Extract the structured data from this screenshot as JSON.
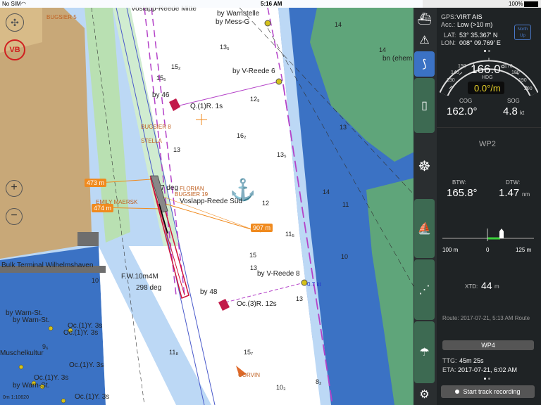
{
  "status": {
    "carrier": "No SIM",
    "time": "5:16 AM",
    "battery": "100%"
  },
  "map": {
    "labels": {
      "voslapp_mitte": "Voslapp-Reede Mitte",
      "warnstelle": "by Warnstelle",
      "mess_g": "by Mess-G",
      "bugsier5": "BUGSIER 5",
      "v_reede6": "by V-Reede 6",
      "by46": "by 46",
      "q1r": "Q.(1)R. 1s",
      "bugsier": "BUGSIER 8",
      "stella": "STELLA",
      "deg_label": "7 deg",
      "florian": "FLORIAN",
      "bugsier19": "BUGSIER 19",
      "voslapp_sued": "Voslapp-Reede Süd",
      "maersk": "EMILY MAERSK",
      "bulk": "Bulk Terminal Wilhelmshaven",
      "fw": "F.W.10m4M",
      "deg298": "298 deg",
      "v_reede8": "by V-Reede 8",
      "kt07": "0.7 kt",
      "by48": "by 48",
      "oc3r": "Oc.(3)R. 12s",
      "warn_st1": "by Warn-St.",
      "warn_st2": "by Warn-St.",
      "oc1y_a": "Oc.(1)Y. 3s",
      "oc1y_b": "Oc.(1)Y. 3s",
      "muschel": "Muschelkultur",
      "oc1y_c": "Oc.(1)Y. 3s",
      "oc1y_d": "Oc.(1)Y. 3s",
      "warn_st3": "by Warn-St.",
      "oc1y_e": "Oc.(1)Y. 3s",
      "corvin": "CORVIN",
      "bn_ehem": "bn (ehem",
      "scale": "0m  1:10620",
      "vb": "VB"
    },
    "tags": {
      "t473": "473 m",
      "t474": "474 m",
      "t907": "907 m"
    },
    "depths": [
      "14",
      "13₅",
      "15₅",
      "12₉",
      "14",
      "16₂",
      "13",
      "13₅",
      "12",
      "11₅",
      "15",
      "15₂",
      "14",
      "13",
      "11",
      "13",
      "10",
      "11₈",
      "15₇",
      "10₃",
      "8₂",
      "13",
      "9₆",
      "10"
    ]
  },
  "side": {
    "north_up": "North Up"
  },
  "panel": {
    "gps_label": "GPS:",
    "gps_value": "VIRT AIS",
    "acc_label": "Acc.:",
    "acc_value": "Low (>10 m)",
    "lat_label": "LAT:",
    "lat_value": "53° 35.367' N",
    "lon_label": "LON:",
    "lon_value": "008° 09.769' E",
    "north_up": "North Up",
    "heading": "166.0°",
    "hdg_label": "HDG",
    "rot": "0.0°/m",
    "compass_ticks": [
      "130",
      "140",
      "150",
      "160",
      "170",
      "180",
      "190",
      "200"
    ],
    "cog_label": "COG",
    "cog_value": "162.0°",
    "sog_label": "SOG",
    "sog_value": "4.8",
    "sog_unit": "kt",
    "wp_name": "WP2",
    "btw_label": "BTW:",
    "btw_value": "165.8°",
    "dtw_label": "DTW:",
    "dtw_value": "1.47",
    "dtw_unit": "nm",
    "xte_left": "100 m",
    "xte_zero": "0",
    "xte_right": "125 m",
    "xtd_label": "XTD:",
    "xtd_value": "44",
    "xtd_unit": "m",
    "route_info": "Route: 2017-07-21, 5:13 AM Route",
    "next_wp": "WP4",
    "ttg_label": "TTG:",
    "ttg_value": "45m 25s",
    "eta_label": "ETA:",
    "eta_value": "2017-07-21, 6:02 AM",
    "track_button": "Start track recording"
  },
  "colors": {
    "land": "#c8a878",
    "water_deep": "#ffffff",
    "water_shallow": "#bcd8f5",
    "water_blue": "#3b72c4",
    "green_flat": "#5fa57a",
    "accent_green": "#3d6a52",
    "route": "#b442c8",
    "tag_orange": "#f08a1e"
  }
}
